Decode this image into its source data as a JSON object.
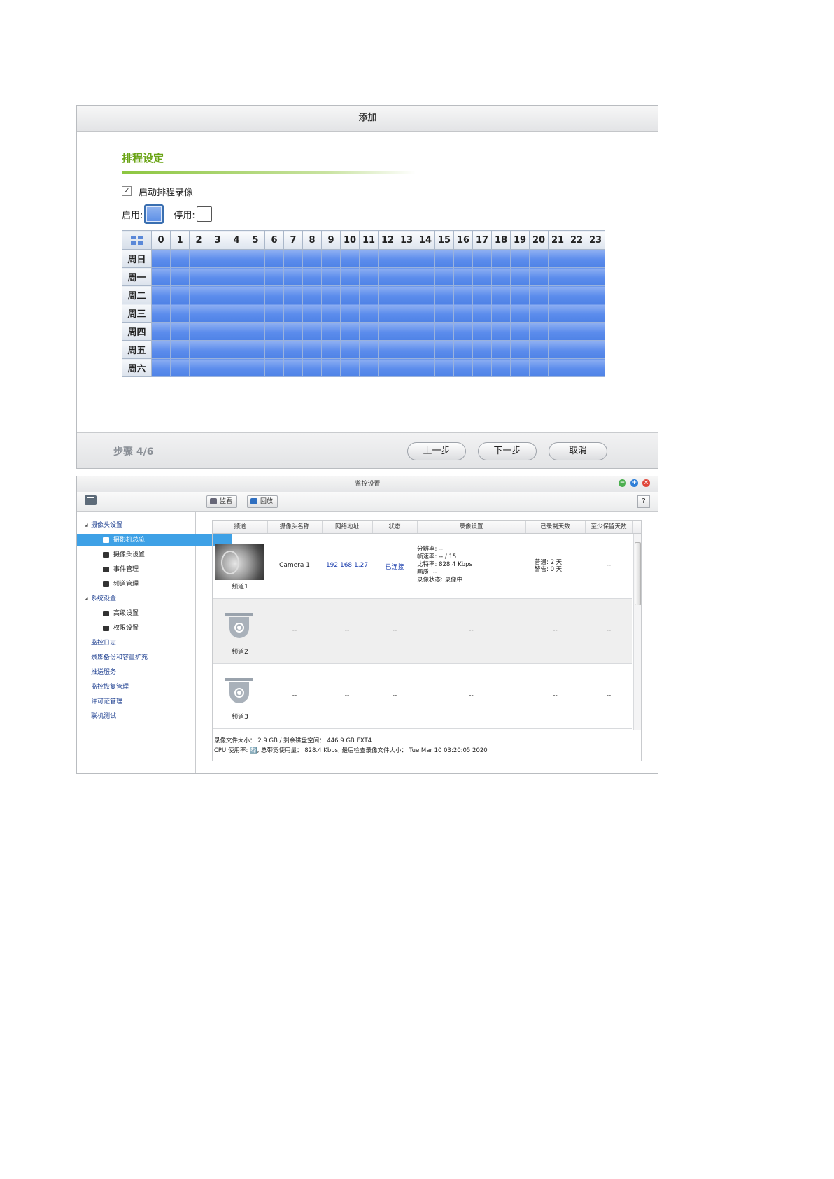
{
  "dialog": {
    "title": "添加",
    "section_title": "排程设定",
    "enable_schedule_label": "启动排程录像",
    "enable_schedule_checked": true,
    "legend_on_label": "启用:",
    "legend_off_label": "停用:",
    "hours": [
      "0",
      "1",
      "2",
      "3",
      "4",
      "5",
      "6",
      "7",
      "8",
      "9",
      "10",
      "11",
      "12",
      "13",
      "14",
      "15",
      "16",
      "17",
      "18",
      "19",
      "20",
      "21",
      "22",
      "23"
    ],
    "days": [
      "周日",
      "周一",
      "周二",
      "周三",
      "周四",
      "周五",
      "周六"
    ],
    "all_slots_enabled": true,
    "step": "步骤 4/6",
    "prev_button": "上一步",
    "next_button": "下一步",
    "cancel_button": "取消",
    "colors": {
      "accent_green": "#6aa416",
      "slot_blue": "#5b8cec"
    }
  },
  "window": {
    "title": "监控设置",
    "toolbar": {
      "monitor_label": "监看",
      "playback_label": "回放",
      "help_label": "?"
    },
    "sidebar": {
      "camera_settings": "摄像头设置",
      "camera_overview": "摄影机总览",
      "camera_config": "摄像头设置",
      "event_mgmt": "事件管理",
      "channel_mgmt": "频道管理",
      "system_settings": "系统设置",
      "advanced": "高级设置",
      "privilege": "权限设置",
      "monitor_log": "监控日志",
      "backup_expand": "录影备份和容量扩充",
      "push_service": "推送服务",
      "recovery": "监控恢复管理",
      "license": "许可证管理",
      "online_test": "联机测试"
    },
    "table": {
      "headers": [
        "频道",
        "摄像头名称",
        "网络地址",
        "状态",
        "录像设置",
        "已录制天数",
        "至少保留天数"
      ],
      "rows": [
        {
          "channel": "频道1",
          "name": "Camera 1",
          "ip": "192.168.1.27",
          "status": "已连接",
          "rec_lines": [
            "分辨率: --",
            "帧速率: -- / 15",
            "比特率: 828.4 Kbps",
            "画质: --",
            "录像状态: 录像中"
          ],
          "days_lines": [
            "普通: 2 天",
            "警告: 0 天"
          ],
          "keep": "--"
        },
        {
          "channel": "频道2",
          "name": "--",
          "ip": "--",
          "status": "--",
          "rec": "--",
          "days": "--",
          "keep": "--"
        },
        {
          "channel": "频道3",
          "name": "--",
          "ip": "--",
          "status": "--",
          "rec": "--",
          "days": "--",
          "keep": "--"
        }
      ]
    },
    "status_line1": "录像文件大小： 2.9 GB / 剩余磁盘空间： 446.9 GB EXT4",
    "status_line2": "CPU 使用率: 🔄, 总带宽使用量： 828.4 Kbps, 最后检查录像文件大小： Tue Mar 10 03:20:05 2020"
  }
}
